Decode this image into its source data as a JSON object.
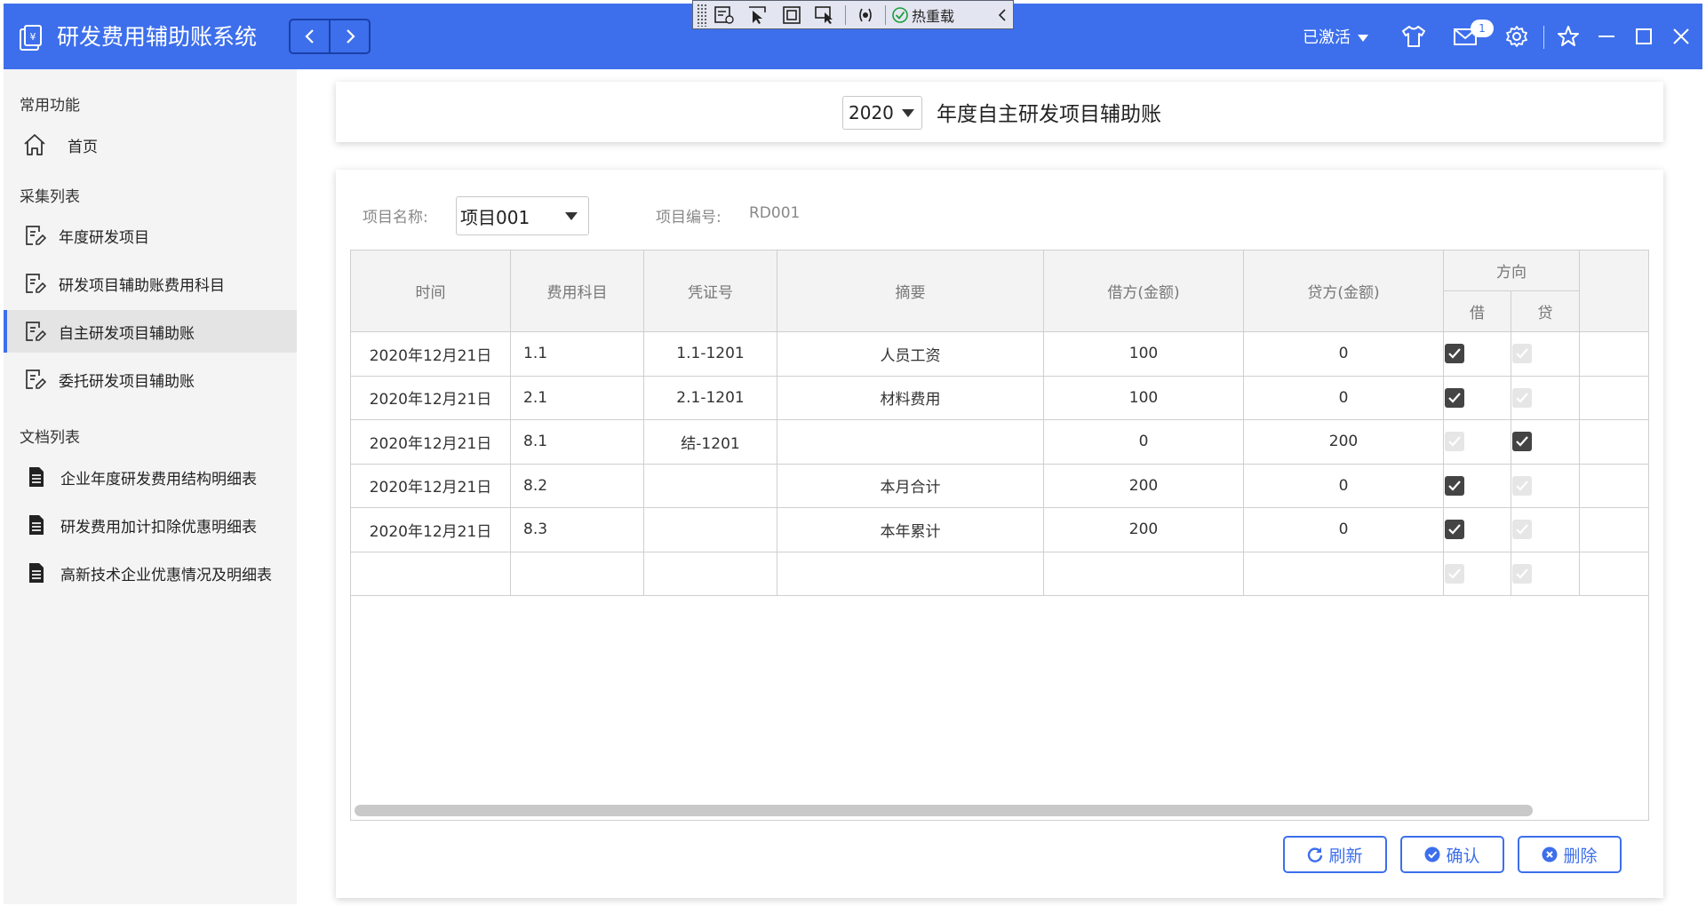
{
  "app": {
    "title": "研发费用辅助账系统",
    "status_label": "已激活",
    "mail_badge": "1"
  },
  "debug_toolbar": {
    "hot_reload_label": "热重载"
  },
  "sidebar": {
    "sections": [
      {
        "title": "常用功能",
        "items": [
          {
            "label": "首页",
            "icon": "home-icon"
          }
        ]
      },
      {
        "title": "采集列表",
        "items": [
          {
            "label": "年度研发项目",
            "icon": "edit-doc-icon"
          },
          {
            "label": "研发项目辅助账费用科目",
            "icon": "edit-doc-icon"
          },
          {
            "label": "自主研发项目辅助账",
            "icon": "edit-doc-icon",
            "active": true
          },
          {
            "label": "委托研发项目辅助账",
            "icon": "edit-doc-icon"
          }
        ]
      },
      {
        "title": "文档列表",
        "items": [
          {
            "label": "企业年度研发费用结构明细表",
            "icon": "document-icon"
          },
          {
            "label": "研发费用加计扣除优惠明细表",
            "icon": "document-icon"
          },
          {
            "label": "高新技术企业优惠情况及明细表",
            "icon": "document-icon"
          }
        ]
      }
    ]
  },
  "header": {
    "year": "2020",
    "title": "年度自主研发项目辅助账"
  },
  "form": {
    "project_name_label": "项目名称:",
    "project_name_value": "项目001",
    "project_code_label": "项目编号:",
    "project_code_value": "RD001"
  },
  "table": {
    "columns": [
      "时间",
      "费用科目",
      "凭证号",
      "摘要",
      "借方(金额)",
      "贷方(金额)"
    ],
    "direction_header": "方向",
    "direction_sub": [
      "借",
      "贷"
    ],
    "rows": [
      {
        "time": "2020年12月21日",
        "subject": "1.1",
        "voucher": "1.1-1201",
        "summary": "人员工资",
        "debit": "100",
        "credit": "0",
        "dir_debit": true,
        "dir_credit": false
      },
      {
        "time": "2020年12月21日",
        "subject": "2.1",
        "voucher": "2.1-1201",
        "summary": "材料费用",
        "debit": "100",
        "credit": "0",
        "dir_debit": true,
        "dir_credit": false
      },
      {
        "time": "2020年12月21日",
        "subject": "8.1",
        "voucher": "结-1201",
        "summary": "",
        "debit": "0",
        "credit": "200",
        "dir_debit": false,
        "dir_credit": true
      },
      {
        "time": "2020年12月21日",
        "subject": "8.2",
        "voucher": "",
        "summary": "本月合计",
        "debit": "200",
        "credit": "0",
        "dir_debit": true,
        "dir_credit": false
      },
      {
        "time": "2020年12月21日",
        "subject": "8.3",
        "voucher": "",
        "summary": "本年累计",
        "debit": "200",
        "credit": "0",
        "dir_debit": true,
        "dir_credit": false
      },
      {
        "time": "",
        "subject": "",
        "voucher": "",
        "summary": "",
        "debit": "",
        "credit": "",
        "dir_debit": false,
        "dir_credit": false
      }
    ]
  },
  "actions": {
    "refresh": "刷新",
    "confirm": "确认",
    "delete": "删除"
  },
  "colors": {
    "accent": "#3d6fec",
    "sidebar_bg": "#f4f4f4",
    "checked": "#444444",
    "unchecked": "#e6e6e6"
  }
}
